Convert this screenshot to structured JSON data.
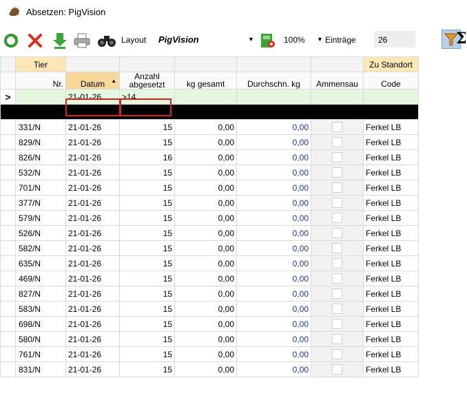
{
  "window": {
    "title": "Absetzen: PigVision"
  },
  "toolbar": {
    "layout_label": "Layout",
    "layout_name": "PigVision",
    "zoom": "100%",
    "entries_label": "Einträge",
    "entries_value": "26",
    "sigma": "Σ",
    "icons": [
      "refresh-icon",
      "delete-icon",
      "download-icon",
      "print-icon",
      "binoculars-icon",
      "layout-save-icon",
      "filter-icon",
      "sum-icon"
    ]
  },
  "grid": {
    "band": {
      "tier": "Tier",
      "zu_standort": "Zu Standort"
    },
    "headers": {
      "nr": "Nr.",
      "datum": "Datum",
      "anzahl_1": "Anzahl",
      "anzahl_2": "abgesetzt",
      "kg_gesamt": "kg gesamt",
      "durchschn": "Durchschn. kg",
      "ammensau": "Ammensau",
      "code": "Code"
    },
    "sort_indicator": "▲",
    "filter_row": {
      "marker": ">",
      "datum": "21-01-26",
      "anzahl": ">14"
    },
    "rows": [
      {
        "nr": "331/N",
        "datum": "21-01-26",
        "anzahl": "15",
        "kg": "0,00",
        "avg": "0,00",
        "code": "Ferkel LB"
      },
      {
        "nr": "829/N",
        "datum": "21-01-26",
        "anzahl": "15",
        "kg": "0,00",
        "avg": "0,00",
        "code": "Ferkel LB"
      },
      {
        "nr": "826/N",
        "datum": "21-01-26",
        "anzahl": "16",
        "kg": "0,00",
        "avg": "0,00",
        "code": "Ferkel LB"
      },
      {
        "nr": "532/N",
        "datum": "21-01-26",
        "anzahl": "15",
        "kg": "0,00",
        "avg": "0,00",
        "code": "Ferkel LB"
      },
      {
        "nr": "701/N",
        "datum": "21-01-26",
        "anzahl": "15",
        "kg": "0,00",
        "avg": "0,00",
        "code": "Ferkel LB"
      },
      {
        "nr": "377/N",
        "datum": "21-01-26",
        "anzahl": "15",
        "kg": "0,00",
        "avg": "0,00",
        "code": "Ferkel LB"
      },
      {
        "nr": "579/N",
        "datum": "21-01-26",
        "anzahl": "15",
        "kg": "0,00",
        "avg": "0,00",
        "code": "Ferkel LB"
      },
      {
        "nr": "526/N",
        "datum": "21-01-26",
        "anzahl": "15",
        "kg": "0,00",
        "avg": "0,00",
        "code": "Ferkel LB"
      },
      {
        "nr": "582/N",
        "datum": "21-01-26",
        "anzahl": "15",
        "kg": "0,00",
        "avg": "0,00",
        "code": "Ferkel LB"
      },
      {
        "nr": "635/N",
        "datum": "21-01-26",
        "anzahl": "15",
        "kg": "0,00",
        "avg": "0,00",
        "code": "Ferkel LB"
      },
      {
        "nr": "469/N",
        "datum": "21-01-26",
        "anzahl": "15",
        "kg": "0,00",
        "avg": "0,00",
        "code": "Ferkel LB"
      },
      {
        "nr": "827/N",
        "datum": "21-01-26",
        "anzahl": "15",
        "kg": "0,00",
        "avg": "0,00",
        "code": "Ferkel LB"
      },
      {
        "nr": "583/N",
        "datum": "21-01-26",
        "anzahl": "15",
        "kg": "0,00",
        "avg": "0,00",
        "code": "Ferkel LB"
      },
      {
        "nr": "698/N",
        "datum": "21-01-26",
        "anzahl": "15",
        "kg": "0,00",
        "avg": "0,00",
        "code": "Ferkel LB"
      },
      {
        "nr": "580/N",
        "datum": "21-01-26",
        "anzahl": "15",
        "kg": "0,00",
        "avg": "0,00",
        "code": "Ferkel LB"
      },
      {
        "nr": "761/N",
        "datum": "21-01-26",
        "anzahl": "15",
        "kg": "0,00",
        "avg": "0,00",
        "code": "Ferkel LB"
      },
      {
        "nr": "831/N",
        "datum": "21-01-26",
        "anzahl": "15",
        "kg": "0,00",
        "avg": "0,00",
        "code": "Ferkel LB"
      }
    ]
  },
  "colors": {
    "avg_value": "#1034c8",
    "filter_row_bg": "#e6f7e0",
    "highlight_box": "#e0201e",
    "sorted_header": "#f7d79a"
  }
}
